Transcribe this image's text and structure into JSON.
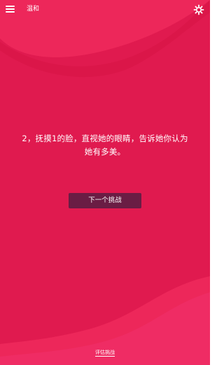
{
  "header": {
    "mode_label": "温和",
    "menu_icon": "hamburger-menu-icon",
    "settings_icon": "settings-gear-icon"
  },
  "challenge": {
    "text": "2，抚摸1的脸，直视她的眼睛，告诉她你认为她有多美。"
  },
  "actions": {
    "next_label": "下一个挑战",
    "rate_label": "评估挑战"
  },
  "colors": {
    "background": "#e01a4f",
    "wave_light": "#ee2a5c",
    "wave_dark": "#c9113f",
    "button": "#6a1d44"
  }
}
